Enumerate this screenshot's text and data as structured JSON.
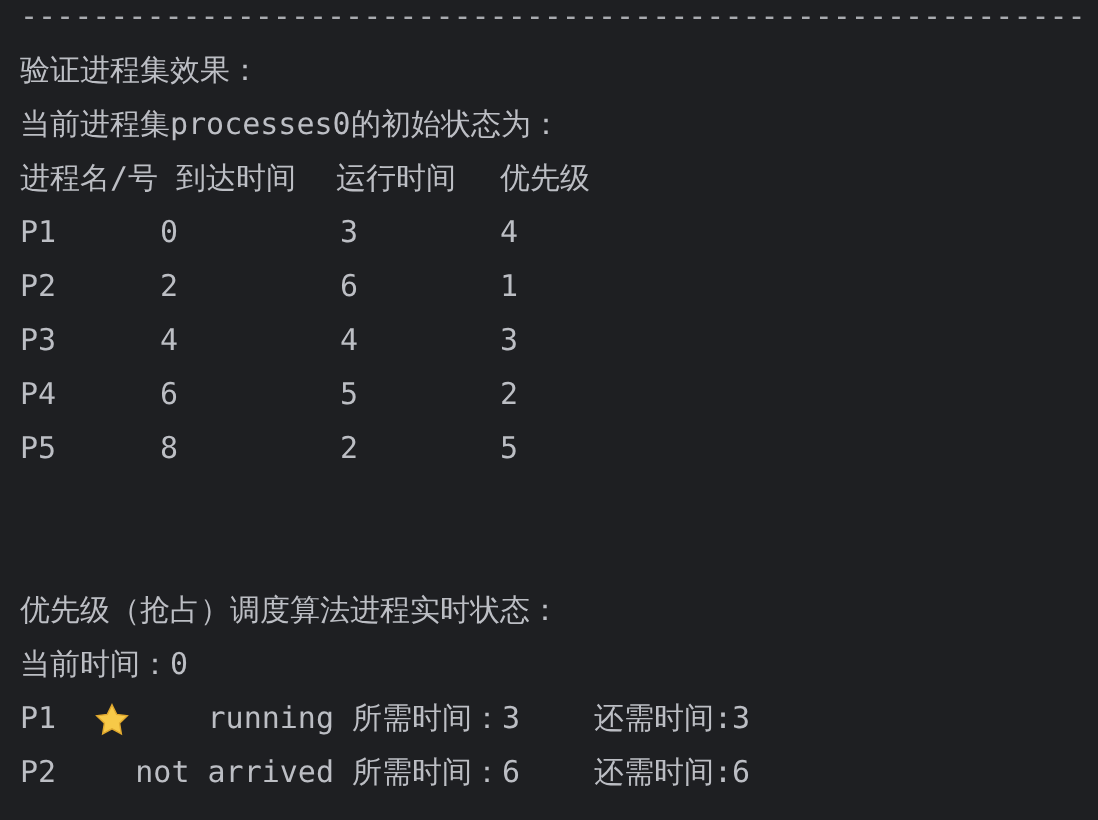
{
  "separator": "-----------------------------------------------------------",
  "intro_lines": [
    "验证进程集效果：",
    "当前进程集processes0的初始状态为："
  ],
  "table": {
    "columns": [
      "进程名/号",
      "到达时间",
      "运行时间",
      "优先级"
    ],
    "rows": [
      [
        "P1",
        "0",
        "3",
        "4"
      ],
      [
        "P2",
        "2",
        "6",
        "1"
      ],
      [
        "P3",
        "4",
        "4",
        "3"
      ],
      [
        "P4",
        "6",
        "5",
        "2"
      ],
      [
        "P5",
        "8",
        "2",
        "5"
      ]
    ]
  },
  "status_title": "优先级（抢占）调度算法进程实时状态：",
  "current_time": "当前时间：0",
  "processes": [
    {
      "name": "P1",
      "running": true,
      "state": "running",
      "needed": "所需时间：3",
      "remaining": "还需时间:3"
    },
    {
      "name": "P2",
      "running": false,
      "state": "not arrived",
      "needed": "所需时间：6",
      "remaining": "还需时间:6"
    }
  ]
}
